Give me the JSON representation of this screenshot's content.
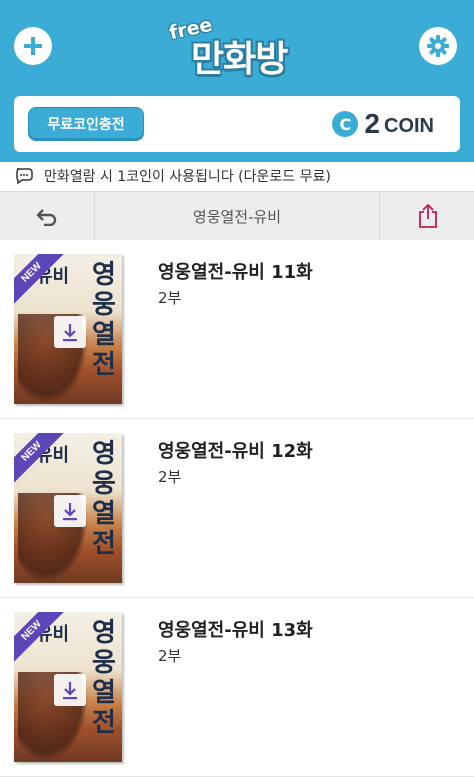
{
  "header": {
    "logo_free": "free",
    "logo_main": "만화방",
    "add_icon": "plus-circle-icon",
    "settings_icon": "gear-icon",
    "accent_color": "#3aacd6"
  },
  "coins": {
    "charge_label": "무료코인충전",
    "coin_symbol": "C",
    "count": "2",
    "unit": "COIN"
  },
  "notice": {
    "icon": "chat-bubble-icon",
    "text": "만화열람 시 1코인이 사용됩니다 (다운로드 무료)"
  },
  "toolbar": {
    "back_icon": "undo-arrow-icon",
    "title": "영웅열전-유비",
    "share_icon": "share-icon"
  },
  "episodes": [
    {
      "title": "영웅열전-유비 11화",
      "subtitle": "2부",
      "badge": "NEW",
      "cover_small": "유비",
      "cover_big": "영웅열전"
    },
    {
      "title": "영웅열전-유비 12화",
      "subtitle": "2부",
      "badge": "NEW",
      "cover_small": "유비",
      "cover_big": "영웅열전"
    },
    {
      "title": "영웅열전-유비 13화",
      "subtitle": "2부",
      "badge": "NEW",
      "cover_small": "유비",
      "cover_big": "영웅열전"
    }
  ]
}
